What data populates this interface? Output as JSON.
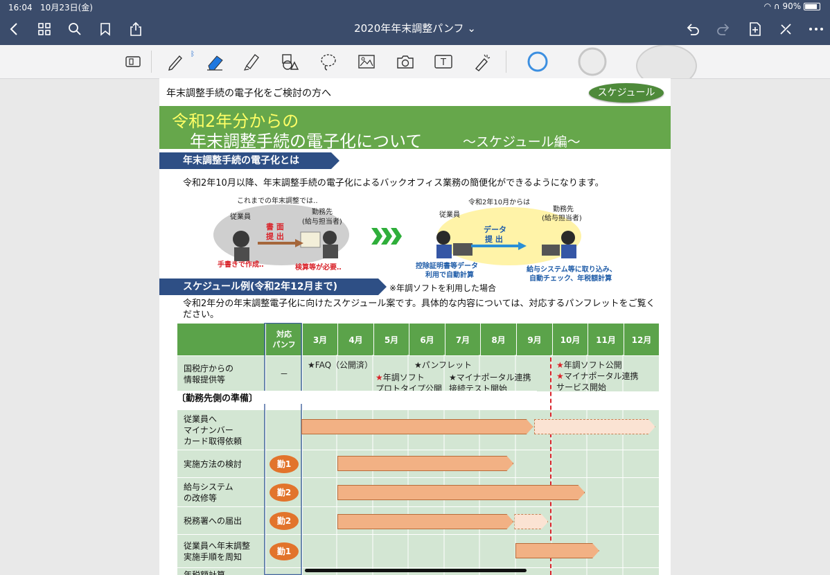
{
  "status": {
    "time": "16:04",
    "date": "10月23日(金)",
    "battery": "90%"
  },
  "nav": {
    "title": "2020年年末調整パンフ",
    "title_chevron": "⌄"
  },
  "toolbar": {
    "icons": [
      "page-layout-icon",
      "pen-icon",
      "bluetooth-icon",
      "eraser-icon",
      "highlighter-icon",
      "shapes-icon",
      "lasso-icon",
      "image-icon",
      "camera-icon",
      "textbox-icon",
      "laser-pointer-icon",
      "color-swatch-blue-icon",
      "color-swatch-gray-icon",
      "color-swatch-transparent-icon"
    ]
  },
  "doc": {
    "heading": "年末調整手続の電子化をご検討の方へ",
    "badge": "スケジュール",
    "banner_line1": "令和2年分からの",
    "banner_line2": "年末調整手続の電子化について",
    "banner_suffix": "～スケジュール編～",
    "section1": "年末調整手続の電子化とは",
    "intro": "令和2年10月以降、年末調整手続の電子化によるバックオフィス業務の簡便化ができるようになります。",
    "illus_left": {
      "caption": "これまでの年末調整では‥",
      "employee": "従業員",
      "employer_1": "勤務先",
      "employer_2": "(給与担当者)",
      "action_1": "書 面",
      "action_2": "提 出",
      "note_left": "手書きで作成‥",
      "note_right": "検算等が必要‥"
    },
    "illus_right": {
      "caption": "令和2年10月からは",
      "employee": "従業員",
      "employer_1": "勤務先",
      "employer_2": "(給与担当者)",
      "action_1": "データ",
      "action_2": "提 出",
      "note_left_1": "控除証明書等データ",
      "note_left_2": "利用で自動計算",
      "note_right_1": "給与システム等に取り込み、",
      "note_right_2": "自動チェック、年税額計算"
    },
    "section2": "スケジュール例(令和2年12月まで)",
    "section2_note": "※年調ソフトを利用した場合",
    "desc": "令和2年分の年末調整電子化に向けたスケジュール案です。具体的な内容については、対応するパンフレットをご覧ください。",
    "table": {
      "corner": "",
      "pamphlet_header": "対応\nパンフ",
      "months": [
        "3月",
        "4月",
        "5月",
        "6月",
        "7月",
        "8月",
        "9月",
        "10月",
        "11月",
        "12月"
      ],
      "nta_row": {
        "label": "国税庁からの\n情報提供等",
        "pamphlet": "－",
        "events": [
          {
            "star": "★",
            "text": "FAQ（公開済）",
            "red": false
          },
          {
            "star": "★",
            "text": "年調ソフト\nプロトタイプ公開",
            "red": true
          },
          {
            "star": "★",
            "text": "パンフレット",
            "red": false
          },
          {
            "star": "★",
            "text": "マイナポータル連携\n接続テスト開始",
            "red": false
          },
          {
            "star": "★",
            "text": "年調ソフト公開",
            "red": true
          },
          {
            "star": "★",
            "text": "マイナポータル連携\nサービス開始",
            "red": true
          }
        ]
      },
      "section_label": "〔勤務先側の準備〕",
      "tasks": [
        {
          "label": "従業員へ\nマイナンバー\nカード取得依頼",
          "badge": "",
          "start": 3,
          "end": 9.5,
          "dashed_to": 12.9
        },
        {
          "label": "実施方法の検討",
          "badge": "勤1",
          "start": 4,
          "end": 8.95,
          "dashed_to": null
        },
        {
          "label": "給与システム\nの改修等",
          "badge": "勤2",
          "start": 4,
          "end": 10.95,
          "dashed_to": null
        },
        {
          "label": "税務署への届出",
          "badge": "勤2",
          "start": 4,
          "end": 8.95,
          "dashed_to": 9.9
        },
        {
          "label": "従業員へ年末調整\n実施手順を周知",
          "badge": "勤1",
          "start": 9,
          "end": 11.35,
          "dashed_to": null
        },
        {
          "label": "年税額計算",
          "badge": "",
          "start": null,
          "end": null,
          "dashed_to": null
        }
      ]
    }
  }
}
